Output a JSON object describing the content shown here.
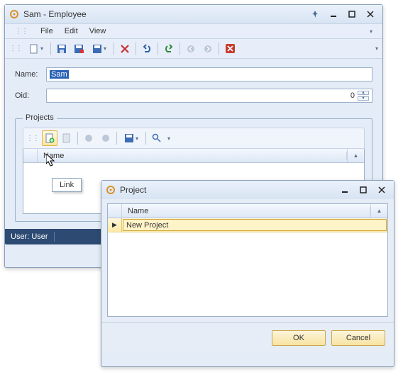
{
  "main": {
    "title": "Sam - Employee",
    "menu": {
      "file": "File",
      "edit": "Edit",
      "view": "View"
    },
    "form": {
      "name_label": "Name:",
      "name_value": "Sam",
      "oid_label": "Oid:",
      "oid_value": "0"
    },
    "projects": {
      "legend": "Projects",
      "col_name": "Name",
      "tooltip": "Link"
    },
    "status": {
      "user": "User: User"
    }
  },
  "dialog": {
    "title": "Project",
    "col_name": "Name",
    "rows": [
      {
        "name": "New Project"
      }
    ],
    "ok": "OK",
    "cancel": "Cancel"
  },
  "icons": {
    "gear": "gear",
    "pin": "pin"
  }
}
